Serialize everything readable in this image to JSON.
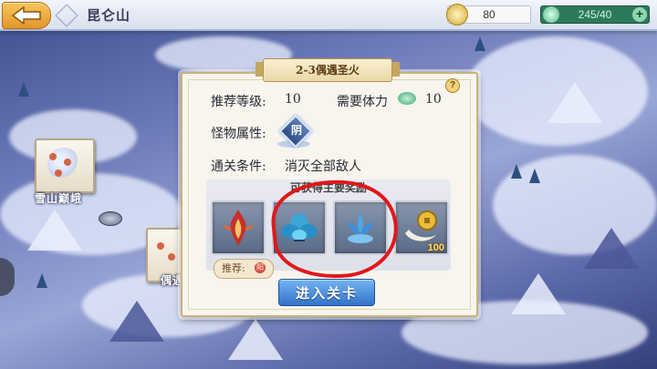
{
  "topbar": {
    "title": "昆仑山",
    "gold": "80",
    "stamina": "245/40",
    "plus": "+"
  },
  "map": {
    "node1_label": "雪山巅峨",
    "node2_label": "偶遇"
  },
  "dialog": {
    "header": "2-3偶遇圣火",
    "help": "?",
    "rec_level_label": "推荐等级:",
    "rec_level_value": "10",
    "stamina_label": "需要体力",
    "stamina_value": "10",
    "attr_label": "怪物属性:",
    "attr_value": "阴",
    "clear_label": "通关条件:",
    "clear_value": "消灭全部敌人",
    "reward_title": "可获得主要奖励",
    "rewards": [
      {
        "icon": "flame-emblem-icon",
        "count": ""
      },
      {
        "icon": "blue-flower-icon",
        "count": ""
      },
      {
        "icon": "blue-lotus-icon",
        "count": ""
      },
      {
        "icon": "gold-coin-icon",
        "count": "100"
      }
    ],
    "recommend_label": "推荐:",
    "recommend_mini": "阳",
    "enter_button": "进入关卡"
  },
  "colors": {
    "enter_button": "#3f86db",
    "stamina_bar": "#2d7a5b",
    "annotation_circle": "#e0181b"
  }
}
